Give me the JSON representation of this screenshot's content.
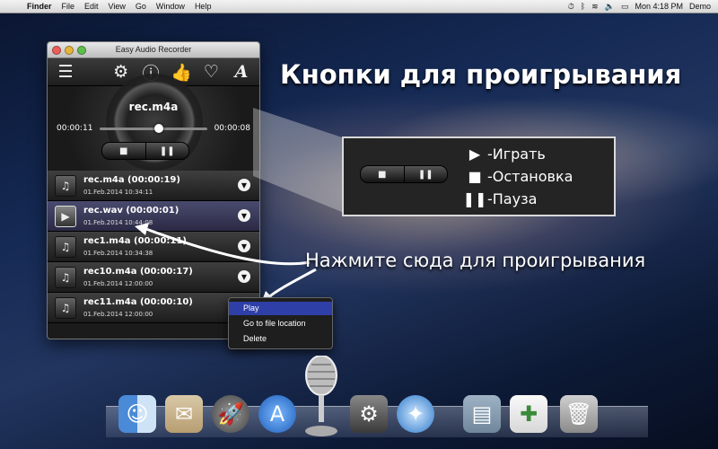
{
  "menubar": {
    "apple": "",
    "items": [
      "Finder",
      "File",
      "Edit",
      "View",
      "Go",
      "Window",
      "Help"
    ],
    "clock": "Mon 4:18 PM",
    "user": "Demo"
  },
  "window": {
    "title": "Easy Audio Recorder",
    "toolbar_icons": [
      "list-icon",
      "gear-icon",
      "info-icon",
      "thumbs-up-icon",
      "heart-icon",
      "font-icon"
    ],
    "player": {
      "file": "rec.m4a",
      "elapsed": "00:00:11",
      "total": "00:00:08",
      "progress": 0.5,
      "stop": "■",
      "pause": "❚❚"
    },
    "recordings": [
      {
        "name": "rec.m4a (00:00:19)",
        "date": "01.Feb.2014 10:34:11",
        "icon": "♫",
        "selected": false
      },
      {
        "name": "rec.wav (00:00:01)",
        "date": "01.Feb.2014 10:44:08",
        "icon": "▶",
        "selected": true
      },
      {
        "name": "rec1.m4a (00:00:11)",
        "date": "01.Feb.2014 10:34:38",
        "icon": "♫",
        "selected": false
      },
      {
        "name": "rec10.m4a (00:00:17)",
        "date": "01.Feb.2014 12:00:00",
        "icon": "♫",
        "selected": false
      },
      {
        "name": "rec11.m4a (00:00:10)",
        "date": "01.Feb.2014 12:00:00",
        "icon": "♫",
        "selected": false
      }
    ]
  },
  "context_menu": {
    "items": [
      "Play",
      "Go to file location",
      "Delete"
    ],
    "highlighted": "Play"
  },
  "overlay": {
    "heading": "Кнопки  для проигрывания",
    "legend": [
      {
        "glyph": "▶",
        "label": "-Играть"
      },
      {
        "glyph": "■",
        "label": "-Остановка"
      },
      {
        "glyph": "❚❚",
        "label": "-Пауза"
      }
    ],
    "hint": "Нажмите сюда для проигрывания"
  },
  "dock": {
    "icons": [
      "finder-icon",
      "mail-icon",
      "launchpad-icon",
      "app-store-icon",
      "microphone-icon",
      "system-preferences-icon",
      "safari-icon",
      "documents-folder-icon",
      "file-icon",
      "trash-icon"
    ]
  }
}
